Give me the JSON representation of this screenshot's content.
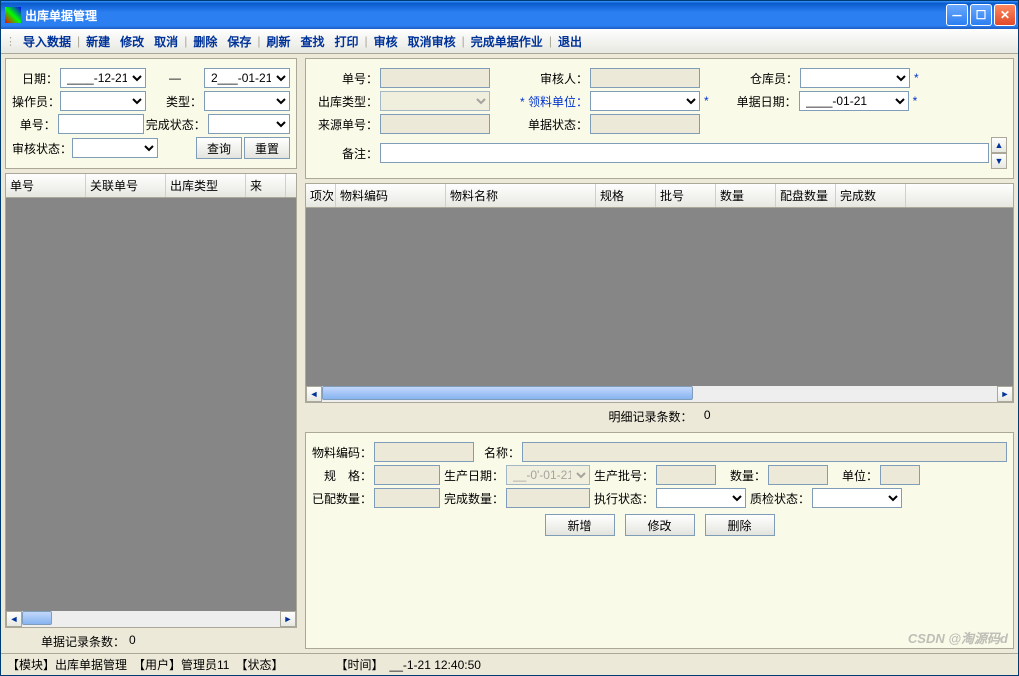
{
  "title": "出库单据管理",
  "toolbar": [
    "导入数据",
    "新建",
    "修改",
    "取消",
    "删除",
    "保存",
    "刷新",
    "查找",
    "打印",
    "审核",
    "取消审核",
    "完成单据作业",
    "退出"
  ],
  "toolbar_breaks": [
    0,
    3,
    5,
    8,
    10,
    11
  ],
  "leftFilter": {
    "dateLabel": "日期：",
    "dateFrom": "____-12-21",
    "dateSep": "—",
    "dateTo": "2___-01-21",
    "operatorLabel": "操作员：",
    "operator": "",
    "typeLabel": "类型：",
    "type": "",
    "billNoLabel": "单号：",
    "billNo": "",
    "finishLabel": "完成状态：",
    "finish": "",
    "auditLabel": "审核状态：",
    "audit": "",
    "btnQuery": "查询",
    "btnReset": "重置"
  },
  "leftGrid": {
    "cols": [
      "单号",
      "关联单号",
      "出库类型",
      "来"
    ]
  },
  "leftCount": {
    "label": "单据记录条数：",
    "value": "0"
  },
  "header": {
    "billNoLbl": "单号：",
    "billNo": "",
    "auditorLbl": "审核人：",
    "auditor": "",
    "keeperLbl": "仓库员：",
    "keeper": "",
    "outTypeLbl": "出库类型：",
    "outType": "",
    "deptLbl": "领料单位：",
    "dept": "",
    "billDateLbl": "单据日期：",
    "billDate": "____-01-21",
    "srcNoLbl": "来源单号：",
    "srcNo": "",
    "stateLbl": "单据状态：",
    "state": "",
    "remarkLbl": "备注："
  },
  "detailGrid": {
    "cols": [
      "项次",
      "物料编码",
      "物料名称",
      "规格",
      "批号",
      "数量",
      "配盘数量",
      "完成数"
    ]
  },
  "detailCount": {
    "label": "明细记录条数：",
    "value": "0"
  },
  "editPanel": {
    "matNoLbl": "物料编码：",
    "matNo": "",
    "nameLbl": "名称：",
    "name": "",
    "specLbl": "规　格：",
    "spec": "",
    "prodDateLbl": "生产日期：",
    "prodDate": "__-0'-01-21",
    "lotLbl": "生产批号：",
    "lot": "",
    "qtyLbl": "数量：",
    "qty": "",
    "uomLbl": "单位：",
    "uom": "",
    "assignedLbl": "已配数量：",
    "assigned": "",
    "doneQtyLbl": "完成数量：",
    "doneQty": "",
    "execLbl": "执行状态：",
    "exec": "",
    "qcLbl": "质检状态：",
    "qc": "",
    "btnAdd": "新增",
    "btnMod": "修改",
    "btnDel": "删除"
  },
  "status": {
    "module": "【模块】出库单据管理",
    "user": "【用户】管理员11",
    "state": "【状态】",
    "timeLbl": "【时间】",
    "time": "__-1-21 12:40:50"
  },
  "watermark": "CSDN @淘源码d"
}
